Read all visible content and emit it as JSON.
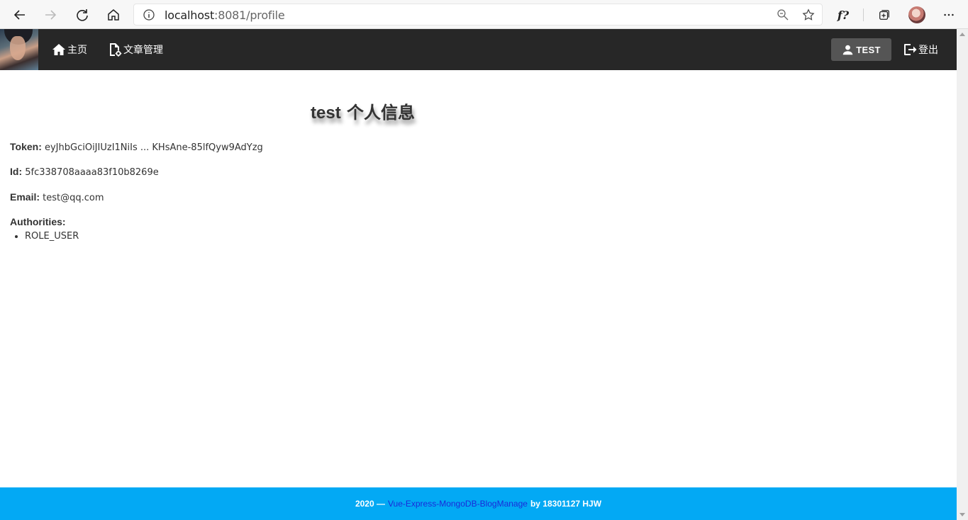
{
  "browser": {
    "url_host": "localhost",
    "url_path": ":8081/profile",
    "reading_mode_label": "f?",
    "icons": [
      "back-icon",
      "forward-icon",
      "refresh-icon",
      "home-icon",
      "info-icon",
      "zoom-icon",
      "star-icon",
      "collections-icon",
      "profile-avatar",
      "more-icon"
    ]
  },
  "navbar": {
    "home_label": "主页",
    "articles_label": "文章管理",
    "user_label": "TEST",
    "logout_label": "登出"
  },
  "profile": {
    "title_name": "test",
    "title_suffix": " 个人信息",
    "token_label": "Token:",
    "token_value": " eyJhbGciOiJIUzI1NiIs ... KHsAne-85lfQyw9AdYzg",
    "id_label": "Id:",
    "id_value": " 5fc338708aaaa83f10b8269e",
    "email_label": "Email:",
    "email_value": " test@qq.com",
    "authorities_label": "Authorities:",
    "authorities": [
      "ROLE_USER"
    ]
  },
  "footer": {
    "year": "2020 —",
    "link_text": "Vue-Express-MongoDB-BlogManage",
    "by_text": "by 18301127 HJW"
  },
  "colors": {
    "navbar_bg": "#272727",
    "user_button_bg": "#555555",
    "footer_bg": "#03a9f4",
    "footer_link": "#1a2bd9"
  }
}
